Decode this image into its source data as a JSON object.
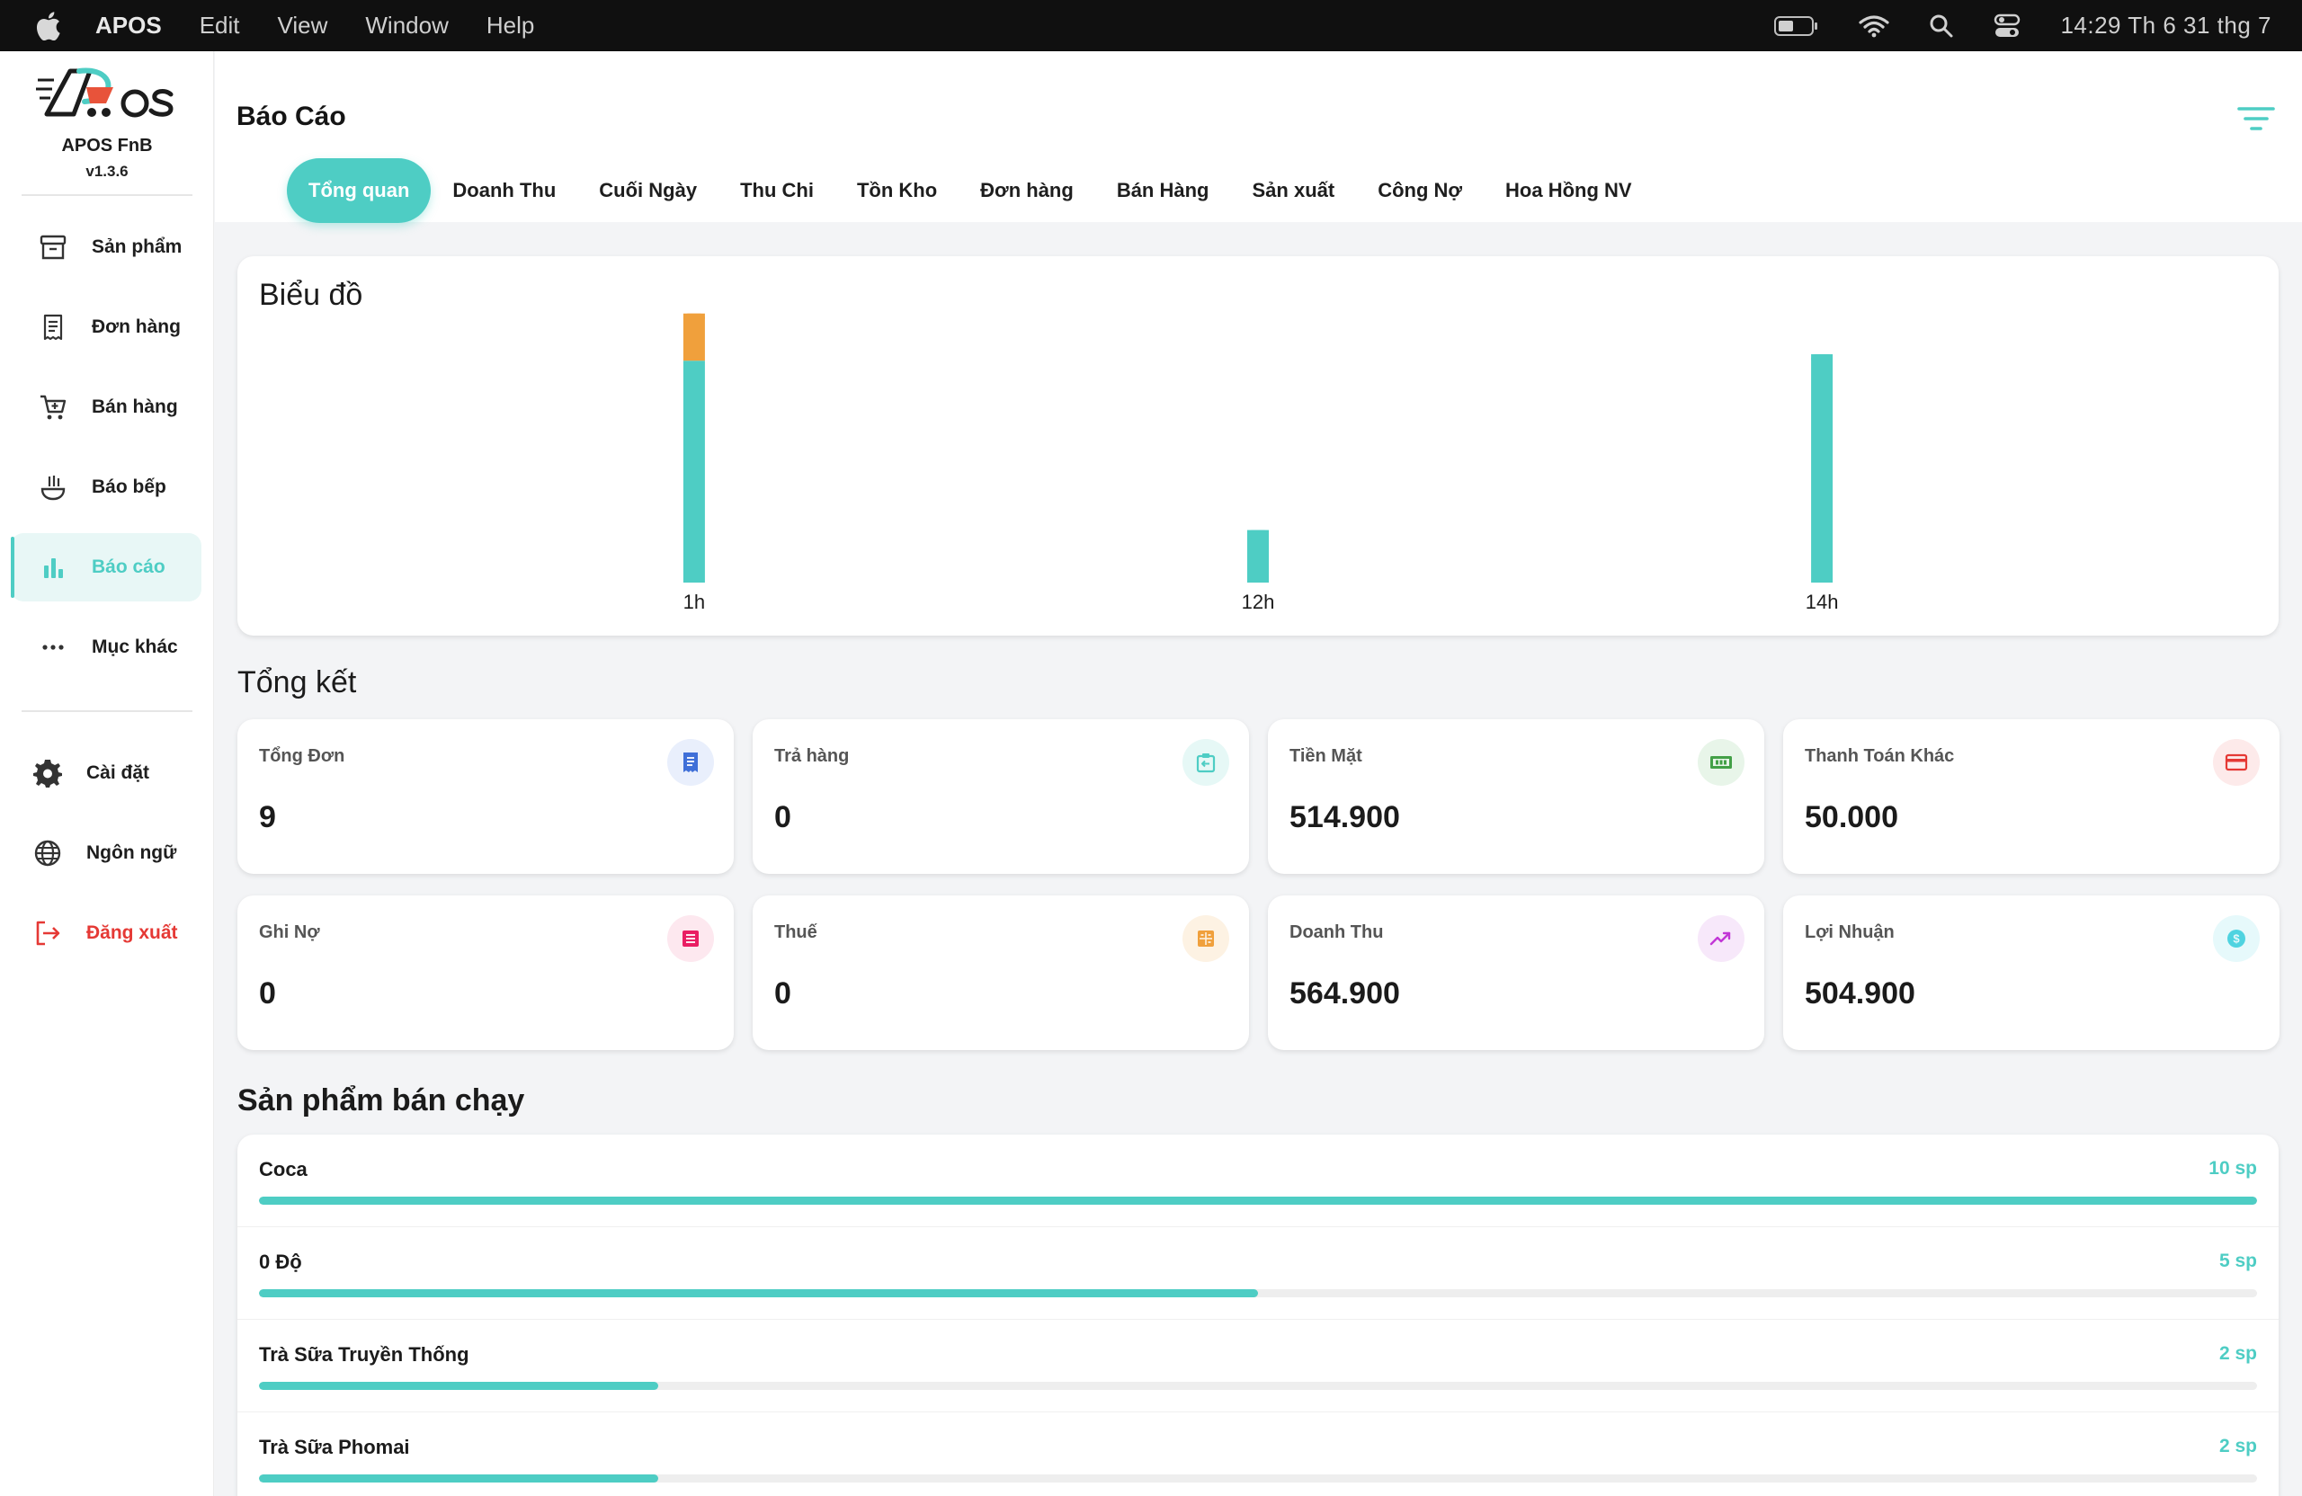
{
  "menubar": {
    "app_name": "APOS",
    "menus": [
      "Edit",
      "View",
      "Window",
      "Help"
    ],
    "clock": "14:29 Th 6 31 thg 7"
  },
  "sidebar": {
    "brand_name": "APOS FnB",
    "version": "v1.3.6",
    "items": [
      {
        "label": "Sản phẩm",
        "icon": "archive-icon"
      },
      {
        "label": "Đơn hàng",
        "icon": "receipt-icon"
      },
      {
        "label": "Bán hàng",
        "icon": "cart-icon"
      },
      {
        "label": "Báo bếp",
        "icon": "kitchen-icon"
      },
      {
        "label": "Báo cáo",
        "icon": "bar-chart-icon",
        "active": true
      },
      {
        "label": "Mục khác",
        "icon": "more-icon"
      }
    ],
    "bottom_items": [
      {
        "label": "Cài đặt",
        "icon": "gear-icon"
      },
      {
        "label": "Ngôn ngữ",
        "icon": "globe-icon"
      },
      {
        "label": "Đăng xuất",
        "icon": "logout-icon"
      }
    ]
  },
  "header": {
    "title": "Báo Cáo",
    "tabs": [
      "Tổng quan",
      "Doanh Thu",
      "Cuối Ngày",
      "Thu Chi",
      "Tồn Kho",
      "Đơn hàng",
      "Bán Hàng",
      "Sản xuất",
      "Công Nợ",
      "Hoa Hồng NV"
    ],
    "active_tab": "Tổng quan"
  },
  "chart_section": {
    "title": "Biểu đồ"
  },
  "chart_data": {
    "type": "bar",
    "title": "Biểu đồ",
    "categories": [
      "1h",
      "12h",
      "14h"
    ],
    "stacked": true,
    "series": [
      {
        "color": "#4ecdc4",
        "values": [
          207000,
          49000,
          213000
        ]
      },
      {
        "color": "#f0a03c",
        "values": [
          44000,
          0,
          0
        ]
      }
    ],
    "ylim": [
      0,
      260000
    ],
    "grid": false,
    "legend": "none"
  },
  "summary": {
    "title": "Tổng kết",
    "cards": [
      {
        "label": "Tổng Đơn",
        "value": "9",
        "icon": "receipt-icon",
        "color": "#3f6fd8",
        "bg": "#e9effc"
      },
      {
        "label": "Trả hàng",
        "value": "0",
        "icon": "return-box-icon",
        "color": "#4ecdc4",
        "bg": "#e6f8f6"
      },
      {
        "label": "Tiền Mặt",
        "value": "514.900",
        "icon": "cash-icon",
        "color": "#43a047",
        "bg": "#e8f5e9"
      },
      {
        "label": "Thanh Toán Khác",
        "value": "50.000",
        "icon": "credit-card-icon",
        "color": "#e53935",
        "bg": "#fdeaea"
      },
      {
        "label": "Ghi Nợ",
        "value": "0",
        "icon": "debt-note-icon",
        "color": "#e91e63",
        "bg": "#fde8ef"
      },
      {
        "label": "Thuế",
        "value": "0",
        "icon": "tax-icon",
        "color": "#f0a03c",
        "bg": "#fdf2e3"
      },
      {
        "label": "Doanh Thu",
        "value": "564.900",
        "icon": "trending-up-icon",
        "color": "#c237d6",
        "bg": "#f7e8fa"
      },
      {
        "label": "Lợi Nhuận",
        "value": "504.900",
        "icon": "coin-icon",
        "color": "#4fd3e0",
        "bg": "#e6f9fb"
      }
    ]
  },
  "best_sellers": {
    "title": "Sản phẩm bán chạy",
    "items": [
      {
        "name": "Coca",
        "qty": "10 sp",
        "ratio": 1.0
      },
      {
        "name": "0 Độ",
        "qty": "5 sp",
        "ratio": 0.5
      },
      {
        "name": "Trà Sữa Truyền Thống",
        "qty": "2 sp",
        "ratio": 0.2
      },
      {
        "name": "Trà Sữa Phomai",
        "qty": "2 sp",
        "ratio": 0.2
      }
    ]
  }
}
